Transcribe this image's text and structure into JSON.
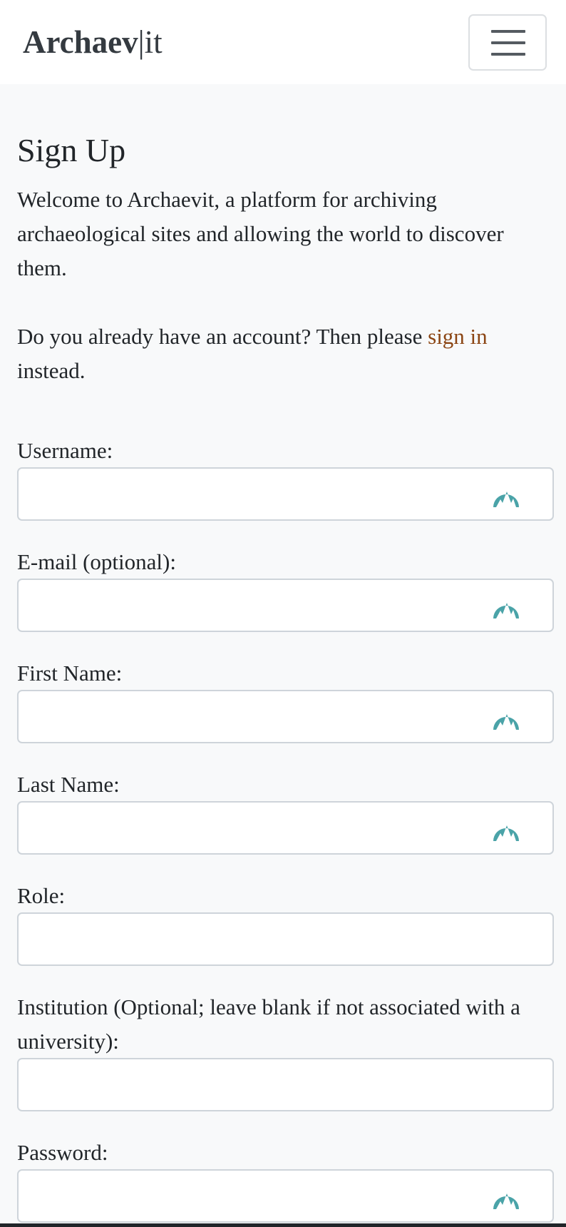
{
  "navbar": {
    "brand_left": "Archaev",
    "brand_bar": "|",
    "brand_right": "it",
    "menu_icon": "hamburger-menu-icon"
  },
  "page": {
    "title": "Sign Up",
    "intro": "Welcome to Archaevit, a platform for archiving archaeological sites and allowing the world to discover them.",
    "signin_prefix": "Do you already have an account? Then please ",
    "signin_link": "sign in",
    "signin_suffix": " instead."
  },
  "form": {
    "fields": [
      {
        "label": "Username:",
        "value": "",
        "autofill_icon": "mountain-icon"
      },
      {
        "label": "E-mail (optional):",
        "value": "",
        "autofill_icon": "mountain-icon"
      },
      {
        "label": "First Name:",
        "value": "",
        "autofill_icon": "mountain-icon"
      },
      {
        "label": "Last Name:",
        "value": "",
        "autofill_icon": "mountain-icon"
      },
      {
        "label": "Role:",
        "value": ""
      },
      {
        "label": "Institution (Optional; leave blank if not associated with a university):",
        "value": ""
      },
      {
        "label": "Password:",
        "value": "",
        "autofill_icon": "mountain-icon"
      }
    ]
  },
  "colors": {
    "link": "#8b4513",
    "autofill_icon": "#4aa3a8",
    "background": "#f8f9fa"
  }
}
